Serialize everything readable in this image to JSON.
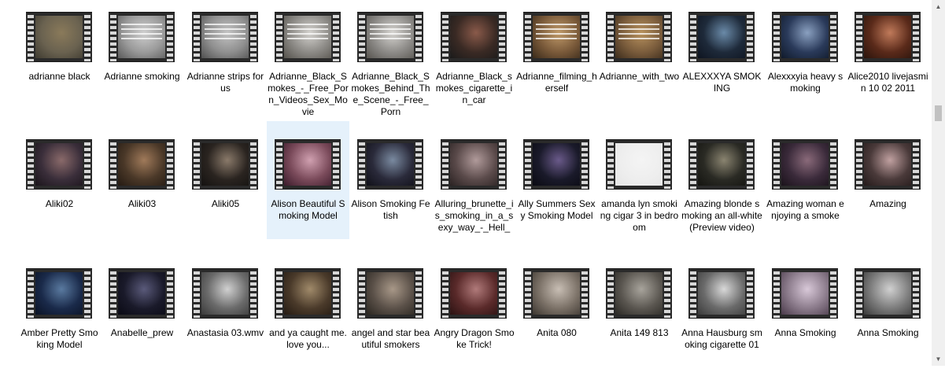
{
  "rows": [
    [
      {
        "label": "adrianne black",
        "colors": [
          "#6a6250",
          "#8a7a5a",
          "#3e3a30"
        ]
      },
      {
        "label": "Adrianne smoking",
        "colors": [
          "#9a9a9a",
          "#cfcfcf",
          "#5a5a5a"
        ],
        "text": true
      },
      {
        "label": "Adrianne strips for us",
        "colors": [
          "#8f8f8f",
          "#c4c4c4",
          "#505050"
        ],
        "text": true
      },
      {
        "label": "Adrianne_Black_Smokes_-_Free_Porn_Videos_Sex_Movie",
        "colors": [
          "#8c8a86",
          "#d4d2ce",
          "#55524c"
        ],
        "text": true
      },
      {
        "label": "Adrianne_Black_Smokes_Behind_The_Scene_-_Free_Porn",
        "colors": [
          "#8d8b88",
          "#d6d4d0",
          "#57544f"
        ],
        "text": true
      },
      {
        "label": "Adrianne_Black_smokes_cigarette_in_car",
        "colors": [
          "#3a2a24",
          "#8a5a4a",
          "#1a1a1a"
        ]
      },
      {
        "label": "Adrianne_filming_herself",
        "colors": [
          "#7a5a3a",
          "#c09a6a",
          "#3a2a1a"
        ],
        "text": true
      },
      {
        "label": "Adrianne_with_two",
        "colors": [
          "#7a5c3c",
          "#b8925e",
          "#3c2c1c"
        ],
        "text": true
      },
      {
        "label": "ALEXXXYA SMOKING",
        "colors": [
          "#1e2a3a",
          "#6a8aa8",
          "#0e1420"
        ]
      },
      {
        "label": "Alexxxyia heavy smoking",
        "colors": [
          "#2a3a5a",
          "#8aa0c0",
          "#101a2a"
        ]
      },
      {
        "label": "Alice2010 livejasmin 10 02 2011",
        "colors": [
          "#5a2a1a",
          "#c07a5a",
          "#2a140c"
        ]
      }
    ],
    [
      {
        "label": "Aliki02",
        "colors": [
          "#3a2e3a",
          "#8a6a6a",
          "#1a141a"
        ]
      },
      {
        "label": "Aliki03",
        "colors": [
          "#4a3828",
          "#a07a5a",
          "#241a12"
        ]
      },
      {
        "label": "Aliki05",
        "colors": [
          "#2a2420",
          "#8a7a6a",
          "#141210"
        ]
      },
      {
        "label": "Alison Beautiful Smoking Model",
        "colors": [
          "#7a4a5a",
          "#d0a0b0",
          "#3a1a2a"
        ]
      },
      {
        "label": "Alison Smoking Fetish",
        "colors": [
          "#2a2a3a",
          "#7a8aa0",
          "#101018"
        ]
      },
      {
        "label": "Alluring_brunette_is_smoking_in_a_sexy_way_-_Hell_",
        "colors": [
          "#5a4a4a",
          "#b09a9a",
          "#2a2222"
        ]
      },
      {
        "label": "Ally Summers Sexy Smoking Model",
        "colors": [
          "#1a1a2a",
          "#6a5a8a",
          "#0a0a12"
        ]
      },
      {
        "label": "amanda lyn smoking cigar 3 in bedroom",
        "colors": [
          "#eeeeee",
          "#f4f4f4",
          "#e6e6e6"
        ]
      },
      {
        "label": "Amazing blonde smoking an all-white (Preview video)",
        "colors": [
          "#2a2a24",
          "#8a8470",
          "#141410"
        ]
      },
      {
        "label": "Amazing woman enjoying a smoke",
        "colors": [
          "#3a2a3a",
          "#8a6a7a",
          "#1a121a"
        ]
      },
      {
        "label": "Amazing",
        "colors": [
          "#4a3a3a",
          "#c0a0a0",
          "#241a1a"
        ]
      }
    ],
    [
      {
        "label": "Amber Pretty Smoking Model",
        "colors": [
          "#1a2a4a",
          "#5a7aa0",
          "#0a1224"
        ]
      },
      {
        "label": "Anabelle_prew",
        "colors": [
          "#1a1a2a",
          "#5a5a7a",
          "#0a0a14"
        ]
      },
      {
        "label": "Anastasia 03.wmv",
        "colors": [
          "#6a6a6a",
          "#d0d0d0",
          "#3a3a3a"
        ]
      },
      {
        "label": "and ya caught me. love you...",
        "colors": [
          "#4a3a2a",
          "#a08a6a",
          "#241a12"
        ]
      },
      {
        "label": "angel and star beautiful smokers",
        "colors": [
          "#5a5048",
          "#a89888",
          "#2a2620"
        ]
      },
      {
        "label": "Angry Dragon Smoke Trick!",
        "colors": [
          "#5a2a2a",
          "#b07a7a",
          "#2a1212"
        ]
      },
      {
        "label": "Anita 080",
        "colors": [
          "#7a7066",
          "#c8beb4",
          "#3c3630"
        ]
      },
      {
        "label": "Anita 149 813",
        "colors": [
          "#5a5650",
          "#a8a49c",
          "#2a2824"
        ]
      },
      {
        "label": "Anna Hausburg smoking cigarette 01",
        "colors": [
          "#6a6a6a",
          "#d8d8d8",
          "#3a3a3a"
        ]
      },
      {
        "label": "Anna Smoking",
        "colors": [
          "#8a7a8a",
          "#d8c8d8",
          "#4a3a4a"
        ]
      },
      {
        "label": "Anna Smoking",
        "colors": [
          "#7a7a7a",
          "#d0d0d0",
          "#3a3a3a"
        ]
      }
    ]
  ],
  "selected": {
    "row": 1,
    "col": 3
  },
  "scrollbar": {
    "up_icon": "▲",
    "down_icon": "▼"
  }
}
